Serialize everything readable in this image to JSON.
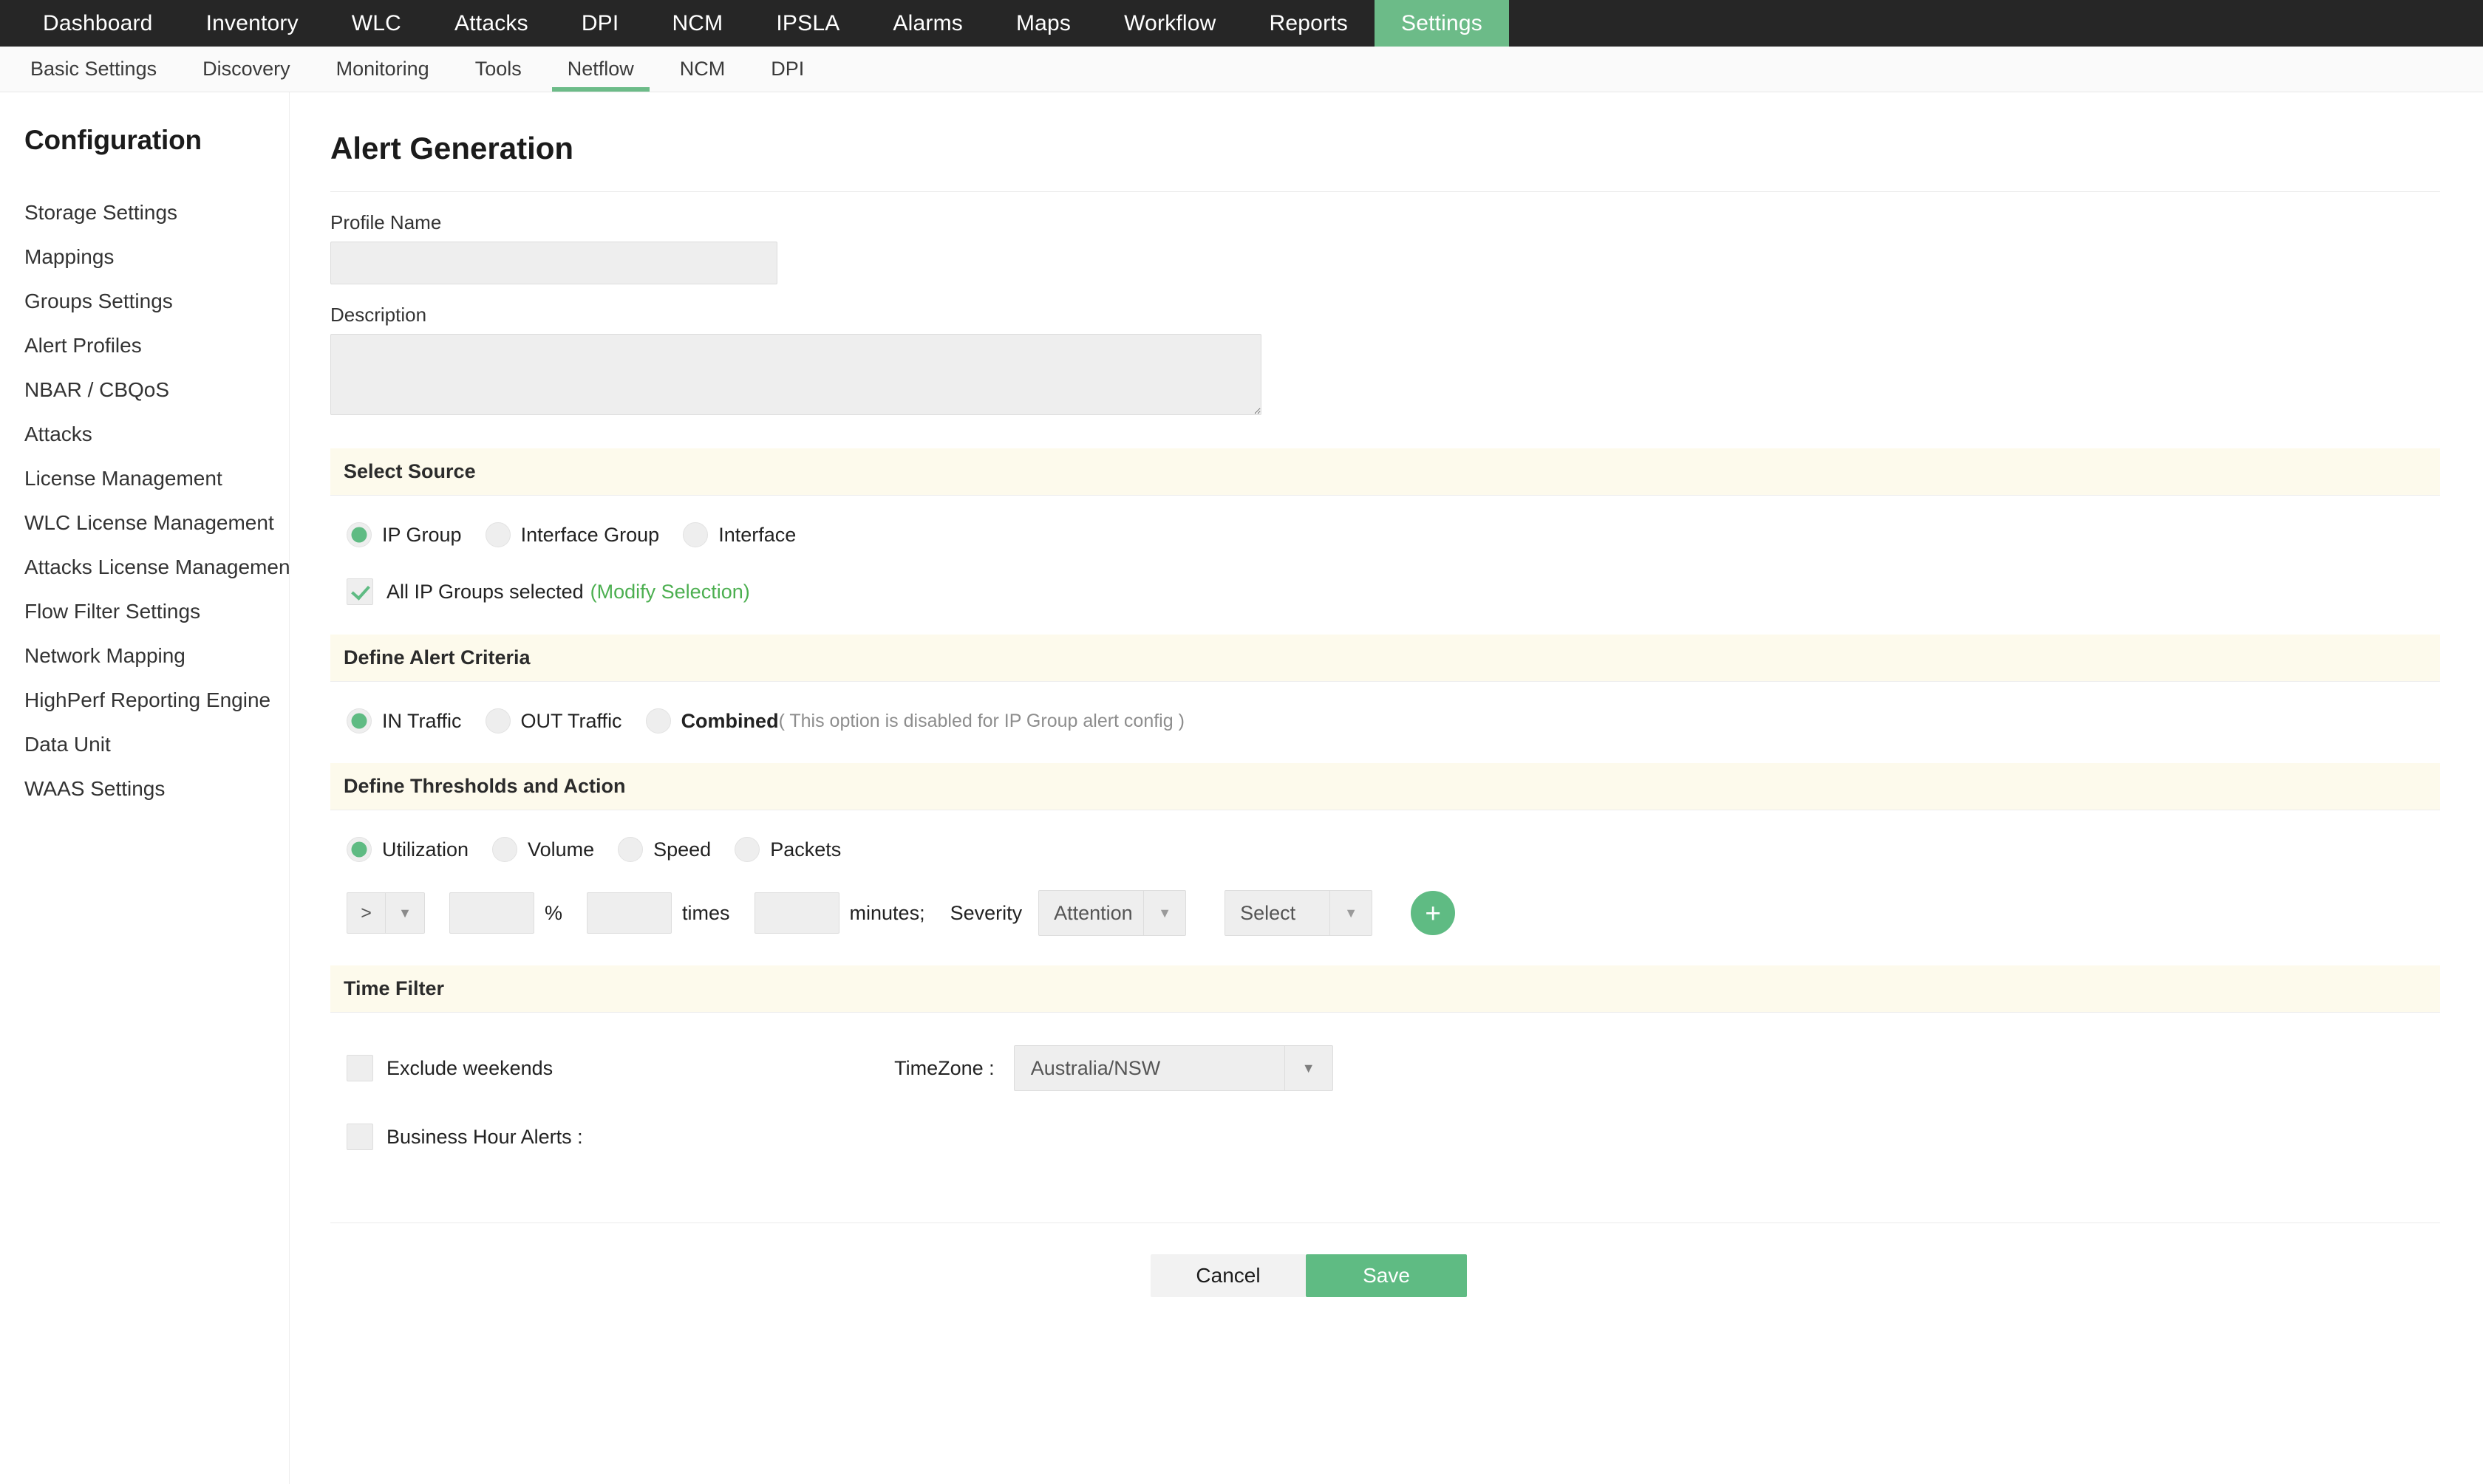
{
  "topnav": {
    "items": [
      {
        "label": "Dashboard",
        "active": false
      },
      {
        "label": "Inventory",
        "active": false
      },
      {
        "label": "WLC",
        "active": false
      },
      {
        "label": "Attacks",
        "active": false
      },
      {
        "label": "DPI",
        "active": false
      },
      {
        "label": "NCM",
        "active": false
      },
      {
        "label": "IPSLA",
        "active": false
      },
      {
        "label": "Alarms",
        "active": false
      },
      {
        "label": "Maps",
        "active": false
      },
      {
        "label": "Workflow",
        "active": false
      },
      {
        "label": "Reports",
        "active": false
      },
      {
        "label": "Settings",
        "active": true
      }
    ]
  },
  "subnav": {
    "items": [
      {
        "label": "Basic Settings",
        "active": false
      },
      {
        "label": "Discovery",
        "active": false
      },
      {
        "label": "Monitoring",
        "active": false
      },
      {
        "label": "Tools",
        "active": false
      },
      {
        "label": "Netflow",
        "active": true
      },
      {
        "label": "NCM",
        "active": false
      },
      {
        "label": "DPI",
        "active": false
      }
    ]
  },
  "sidebar": {
    "title": "Configuration",
    "items": [
      {
        "label": "Storage Settings"
      },
      {
        "label": "Mappings"
      },
      {
        "label": "Groups Settings"
      },
      {
        "label": "Alert Profiles"
      },
      {
        "label": "NBAR / CBQoS"
      },
      {
        "label": "Attacks"
      },
      {
        "label": "License Management"
      },
      {
        "label": "WLC License Management"
      },
      {
        "label": "Attacks License Management"
      },
      {
        "label": "Flow Filter Settings"
      },
      {
        "label": "Network Mapping"
      },
      {
        "label": "HighPerf Reporting Engine"
      },
      {
        "label": "Data Unit"
      },
      {
        "label": "WAAS Settings"
      }
    ]
  },
  "main": {
    "page_title": "Alert Generation",
    "profile_name": {
      "label": "Profile Name",
      "value": "",
      "placeholder": ""
    },
    "description": {
      "label": "Description",
      "value": "",
      "placeholder": ""
    },
    "select_source": {
      "title": "Select Source",
      "options": [
        {
          "label": "IP Group",
          "selected": true
        },
        {
          "label": "Interface Group",
          "selected": false
        },
        {
          "label": "Interface",
          "selected": false
        }
      ],
      "all_selected_label": "All IP Groups selected",
      "all_selected_checked": true,
      "modify_link": "(Modify Selection)"
    },
    "alert_criteria": {
      "title": "Define Alert Criteria",
      "options": [
        {
          "label": "IN Traffic",
          "selected": true,
          "note": ""
        },
        {
          "label": "OUT Traffic",
          "selected": false,
          "note": ""
        },
        {
          "label": "Combined",
          "selected": false,
          "note": "( This option is disabled for IP Group alert config )"
        }
      ]
    },
    "thresholds": {
      "title": "Define Thresholds and Action",
      "metric_options": [
        {
          "label": "Utilization",
          "selected": true
        },
        {
          "label": "Volume",
          "selected": false
        },
        {
          "label": "Speed",
          "selected": false
        },
        {
          "label": "Packets",
          "selected": false
        }
      ],
      "operator_value": ">",
      "threshold_value": "",
      "percent_unit": "%",
      "times_value": "",
      "times_unit": "times",
      "minutes_value": "",
      "minutes_unit": "minutes;",
      "severity_label": "Severity",
      "severity_value": "Attention",
      "action_value": "Select",
      "add_button": "+"
    },
    "time_filter": {
      "title": "Time Filter",
      "exclude_weekends_label": "Exclude weekends",
      "exclude_weekends_checked": false,
      "business_hour_label": "Business Hour Alerts :",
      "business_hour_checked": false,
      "timezone_label": "TimeZone :",
      "timezone_value": "Australia/NSW"
    },
    "footer": {
      "cancel_label": "Cancel",
      "save_label": "Save"
    }
  },
  "colors": {
    "accent_green": "#5fbb83",
    "nav_dark": "#262626",
    "section_bg": "#fdfaec",
    "link_green": "#4caf50"
  }
}
